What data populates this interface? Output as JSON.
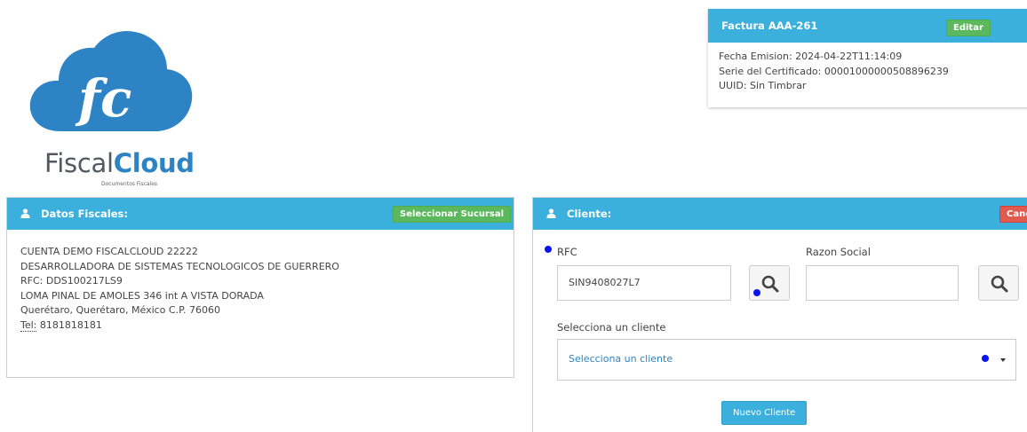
{
  "logo": {
    "brand_light": "Fiscal",
    "brand_bold": "Cloud",
    "tagline": "Documentos Fiscales",
    "cloud_color": "#2d83c4"
  },
  "factura": {
    "title": "Factura AAA-261",
    "edit_label": "Editar",
    "fecha_label": "Fecha Emision:",
    "fecha_value": "2024-04-22T11:14:09",
    "serie_label": "Serie del Certificado:",
    "serie_value": "00001000000508896239",
    "uuid_label": "UUID:",
    "uuid_value": "Sin Timbrar"
  },
  "datos_fiscales": {
    "title": "Datos Fiscales:",
    "select_branch_label": "Seleccionar Sucursal",
    "lines": {
      "account": "CUENTA DEMO FISCALCLOUD 22222",
      "company": "DESARROLLADORA DE SISTEMAS TECNOLOGICOS DE GUERRERO",
      "rfc": "RFC: DDS100217LS9",
      "address": "LOMA PINAL DE AMOLES 346 int A VISTA DORADA",
      "city": "Querétaro, Querétaro, México C.P. 76060",
      "tel_label": "Tel:",
      "tel_value": " 8181818181"
    }
  },
  "cliente": {
    "title": "Cliente:",
    "cancel_label": "Cancelar",
    "rfc_label": "RFC",
    "rfc_value": "SIN9408027L7",
    "razon_label": "Razon Social",
    "razon_value": "",
    "select_label": "Selecciona un cliente",
    "select_value": "Selecciona un cliente",
    "new_client_label": "Nuevo Cliente"
  },
  "colors": {
    "header_blue": "#3bb0dd",
    "green_button": "#5cb85c",
    "red_button": "#e05a4f",
    "marker_dot": "#0a14f0"
  }
}
